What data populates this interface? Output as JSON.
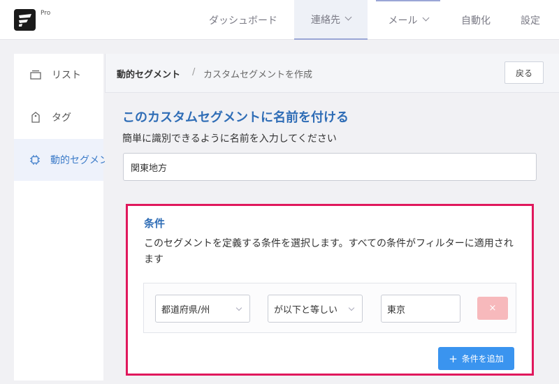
{
  "app": {
    "badge": "Pro",
    "logo_icon": "fluent-logo-icon"
  },
  "nav": {
    "items": [
      {
        "label": "ダッシュボード",
        "dropdown": false,
        "active": false
      },
      {
        "label": "連絡先",
        "dropdown": true,
        "active": true
      },
      {
        "label": "メール",
        "dropdown": true,
        "active": false
      },
      {
        "label": "自動化",
        "dropdown": false,
        "active": false
      },
      {
        "label": "設定",
        "dropdown": false,
        "active": false
      }
    ]
  },
  "sidebar": {
    "items": [
      {
        "label": "リスト",
        "icon": "list-icon",
        "active": false
      },
      {
        "label": "タグ",
        "icon": "tag-icon",
        "active": false
      },
      {
        "label": "動的セグメント",
        "icon": "chip-icon",
        "active": true
      }
    ]
  },
  "breadcrumb": {
    "section": "動的セグメント",
    "separator": "/",
    "page": "カスタムセグメントを作成",
    "back_label": "戻る"
  },
  "form": {
    "title": "このカスタムセグメントに名前を付ける",
    "description": "簡単に識別できるように名前を入力してください",
    "name_value": "関東地方"
  },
  "conditions": {
    "title": "条件",
    "description": "このセグメントを定義する条件を選択します。すべての条件がフィルターに適用されます",
    "rule": {
      "field": "都道府県/州",
      "operator": "が以下と等しい",
      "value": "東京",
      "remove_label": "×"
    },
    "add_label": "条件を追加",
    "add_icon": "plus-icon"
  },
  "colors": {
    "accent": "#2f6db6",
    "highlight_border": "#e0185c",
    "add_button": "#3a94ef",
    "remove_button": "#f7b9bc",
    "active_nav": "#eef1f7"
  }
}
